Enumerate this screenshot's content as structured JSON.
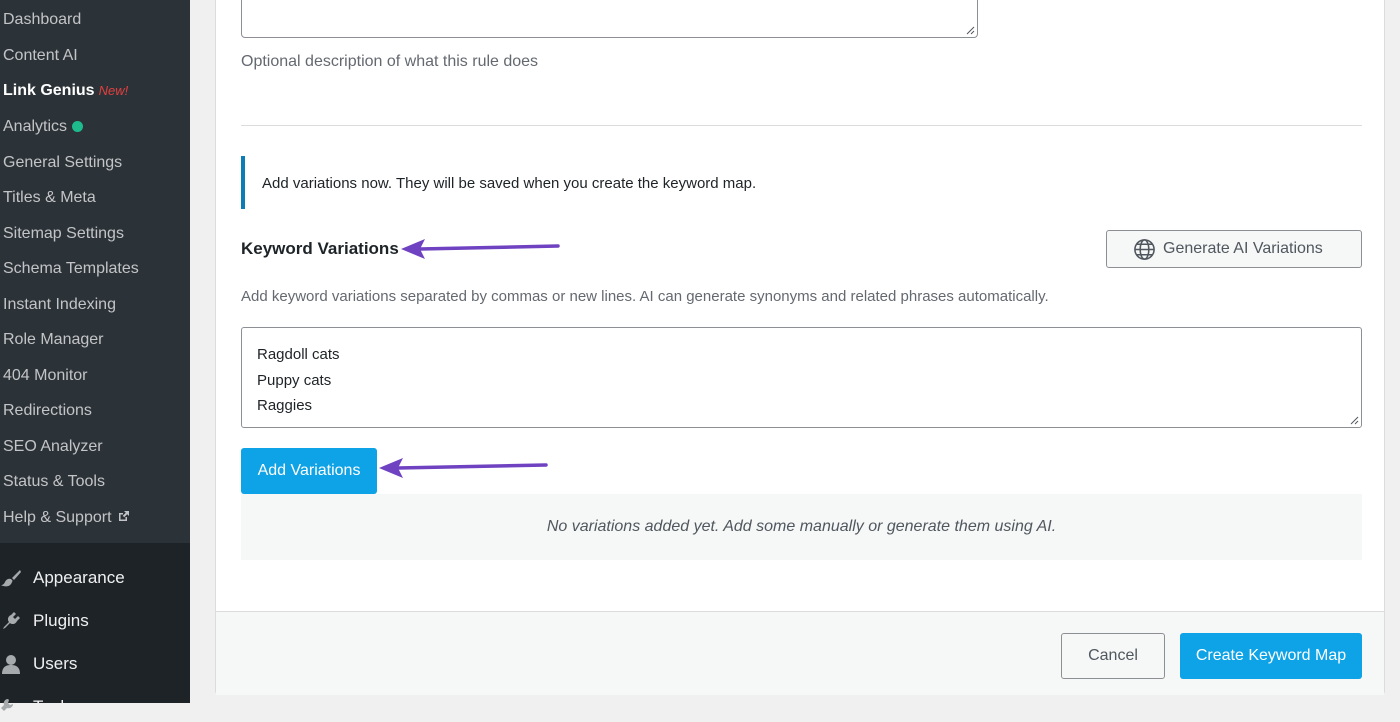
{
  "sidebar": {
    "submenu": [
      {
        "label": "Dashboard"
      },
      {
        "label": "Content AI"
      },
      {
        "label": "Link Genius",
        "badge": "New!"
      },
      {
        "label": "Analytics"
      },
      {
        "label": "General Settings"
      },
      {
        "label": "Titles & Meta"
      },
      {
        "label": "Sitemap Settings"
      },
      {
        "label": "Schema Templates"
      },
      {
        "label": "Instant Indexing"
      },
      {
        "label": "Role Manager"
      },
      {
        "label": "404 Monitor"
      },
      {
        "label": "Redirections"
      },
      {
        "label": "SEO Analyzer"
      },
      {
        "label": "Status & Tools"
      },
      {
        "label": "Help & Support"
      }
    ],
    "menu": [
      {
        "label": "Appearance",
        "icon": "paintbrush-icon"
      },
      {
        "label": "Plugins",
        "icon": "plugin-icon"
      },
      {
        "label": "Users",
        "icon": "users-icon"
      },
      {
        "label": "Tools",
        "icon": "tools-icon"
      }
    ]
  },
  "form": {
    "description_help": "Optional description of what this rule does",
    "notice": "Add variations now. They will be saved when you create the keyword map.",
    "variations_title": "Keyword Variations",
    "generate_button": "Generate AI Variations",
    "variations_help": "Add keyword variations separated by commas or new lines. AI can generate synonyms and related phrases automatically.",
    "variations_value": [
      "Ragdoll cats",
      "Puppy cats",
      "Raggies"
    ],
    "add_button": "Add Variations",
    "empty_state": "No variations added yet. Add some manually or generate them using AI.",
    "cancel_button": "Cancel",
    "create_button": "Create Keyword Map"
  },
  "colors": {
    "accent": "#0ea2e6",
    "annotation_arrow": "#6f42c1",
    "sidebar_bg": "#1d2327",
    "submenu_bg": "#2c3338"
  }
}
